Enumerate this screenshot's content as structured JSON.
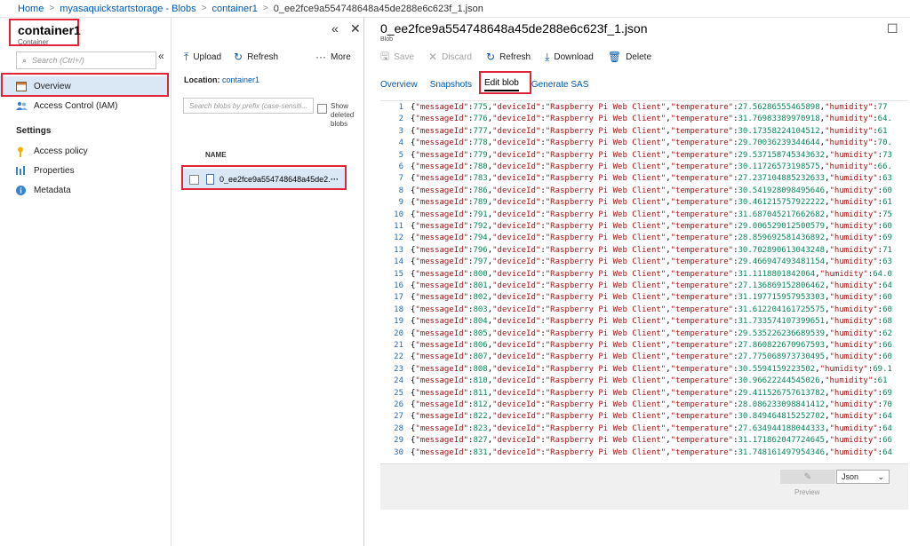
{
  "breadcrumb": {
    "items": [
      "Home",
      "myasaquickstartstorage - Blobs",
      "container1"
    ],
    "current": "0_ee2fce9a554748648a45de288e6c623f_1.json"
  },
  "left_blade": {
    "title": "container1",
    "subtitle": "Container",
    "search_placeholder": "Search (Ctrl+/)",
    "nav": [
      {
        "label": "Overview",
        "icon": "overview-icon",
        "active": true
      },
      {
        "label": "Access Control (IAM)",
        "icon": "iam-people-icon"
      }
    ],
    "settings_heading": "Settings",
    "settings": [
      {
        "label": "Access policy",
        "icon": "key-icon"
      },
      {
        "label": "Properties",
        "icon": "properties-bars-icon"
      },
      {
        "label": "Metadata",
        "icon": "info-icon"
      }
    ]
  },
  "middle_blade": {
    "toolbar": {
      "upload": "Upload",
      "refresh": "Refresh",
      "more": "More"
    },
    "location_label": "Location:",
    "location_value": "container1",
    "search_placeholder": "Search blobs by prefix (case-sensiti...",
    "show_deleted": "Show deleted blobs",
    "col_name": "NAME",
    "file_name": "0_ee2fce9a554748648a45de2..."
  },
  "right_blade": {
    "title": "0_ee2fce9a554748648a45de288e6c623f_1.json",
    "subtitle": "Blob",
    "toolbar": {
      "save": "Save",
      "discard": "Discard",
      "refresh": "Refresh",
      "download": "Download",
      "delete": "Delete"
    },
    "tabs": [
      "Overview",
      "Snapshots",
      "Edit blob",
      "Generate SAS"
    ],
    "active_tab": "Edit blob",
    "preview": "Preview",
    "format": "Json",
    "lines": [
      {
        "id": 775,
        "temp": "27.56286555465898",
        "hum": "77"
      },
      {
        "id": 776,
        "temp": "31.76983389970918",
        "hum": "64."
      },
      {
        "id": 777,
        "temp": "30.17358224104512",
        "hum": "61"
      },
      {
        "id": 778,
        "temp": "29.70036239344644",
        "hum": "70."
      },
      {
        "id": 779,
        "temp": "29.537158745343632",
        "hum": "73"
      },
      {
        "id": 780,
        "temp": "30.11726573198575",
        "hum": "66."
      },
      {
        "id": 783,
        "temp": "27.237104885232633",
        "hum": "63"
      },
      {
        "id": 786,
        "temp": "30.541928098495646",
        "hum": "60"
      },
      {
        "id": 789,
        "temp": "30.461215757922222",
        "hum": "61"
      },
      {
        "id": 791,
        "temp": "31.687045217662682",
        "hum": "75"
      },
      {
        "id": 792,
        "temp": "29.006529012500579",
        "hum": "60"
      },
      {
        "id": 794,
        "temp": "28.859692581436892",
        "hum": "69"
      },
      {
        "id": 796,
        "temp": "30.702890613043248",
        "hum": "71"
      },
      {
        "id": 797,
        "temp": "29.466947493481154",
        "hum": "63"
      },
      {
        "id": 800,
        "temp": "31.1118801842064",
        "hum": "64.0"
      },
      {
        "id": 801,
        "temp": "27.136869152806462",
        "hum": "64"
      },
      {
        "id": 802,
        "temp": "31.197715957953303",
        "hum": "60"
      },
      {
        "id": 803,
        "temp": "31.612204161725575",
        "hum": "60"
      },
      {
        "id": 804,
        "temp": "31.733574107399651",
        "hum": "68"
      },
      {
        "id": 805,
        "temp": "29.535226236689539",
        "hum": "62"
      },
      {
        "id": 806,
        "temp": "27.860822670967593",
        "hum": "66"
      },
      {
        "id": 807,
        "temp": "27.775068973730495",
        "hum": "60"
      },
      {
        "id": 808,
        "temp": "30.5594159223502",
        "hum": "69.1"
      },
      {
        "id": 810,
        "temp": "30.96622244545026",
        "hum": "61"
      },
      {
        "id": 811,
        "temp": "29.411526757613782",
        "hum": "69"
      },
      {
        "id": 812,
        "temp": "28.086233098841412",
        "hum": "70"
      },
      {
        "id": 822,
        "temp": "30.849464815252702",
        "hum": "64"
      },
      {
        "id": 823,
        "temp": "27.634944188044333",
        "hum": "64"
      },
      {
        "id": 827,
        "temp": "31.171862047724645",
        "hum": "66"
      },
      {
        "id": 831,
        "temp": "31.748161497954346",
        "hum": "64"
      }
    ],
    "device": "Raspberry Pi Web Client"
  }
}
